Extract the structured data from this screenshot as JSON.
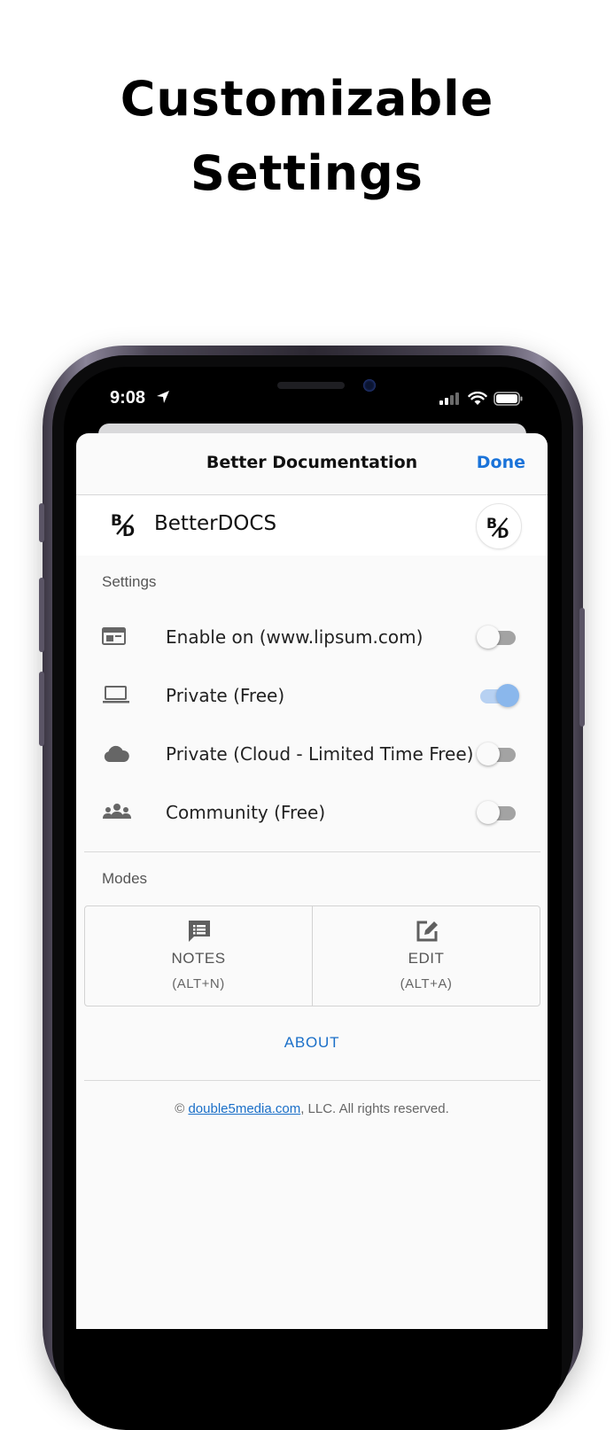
{
  "headline": {
    "line1": "Customizable",
    "line2": "Settings"
  },
  "status_bar": {
    "time": "9:08"
  },
  "nav": {
    "title": "Better Documentation",
    "done_label": "Done"
  },
  "brand": {
    "name": "BetterDOCS"
  },
  "settings": {
    "section_label": "Settings",
    "items": [
      {
        "label": "Enable on (www.lipsum.com)",
        "icon": "browser-window-icon",
        "enabled": false
      },
      {
        "label": "Private (Free)",
        "icon": "laptop-icon",
        "enabled": true
      },
      {
        "label": "Private (Cloud - Limited Time Free)",
        "icon": "cloud-icon",
        "enabled": false
      },
      {
        "label": "Community (Free)",
        "icon": "people-icon",
        "enabled": false
      }
    ]
  },
  "modes": {
    "section_label": "Modes",
    "items": [
      {
        "name": "NOTES",
        "shortcut": "(ALT+N)",
        "icon": "notes-icon"
      },
      {
        "name": "EDIT",
        "shortcut": "(ALT+A)",
        "icon": "edit-icon"
      }
    ]
  },
  "about_label": "ABOUT",
  "footer": {
    "prefix": "© ",
    "link_text": "double5media.com",
    "suffix": ", LLC. All rights reserved."
  },
  "colors": {
    "accent": "#1a73d9",
    "toggle_on": "#8ab7ec",
    "toggle_off": "#a3a3a3"
  }
}
